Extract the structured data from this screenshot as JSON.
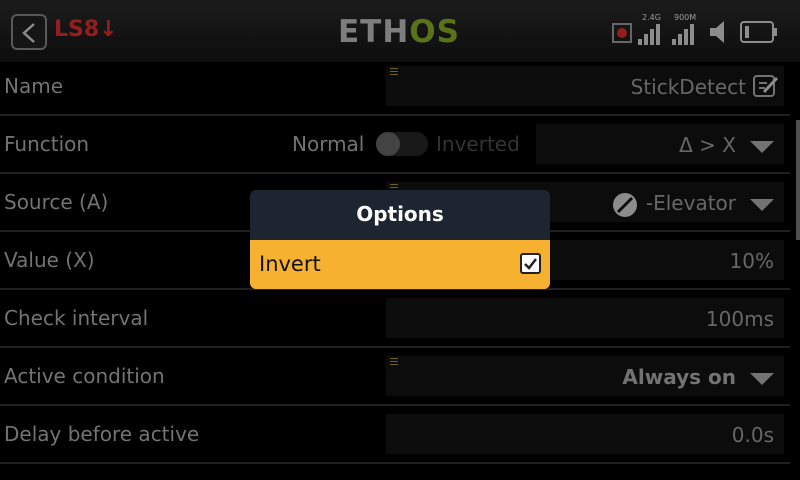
{
  "header": {
    "title": "LS8",
    "title_arrow": "↓",
    "logo_a": "ETH",
    "logo_b": "OS"
  },
  "status": {
    "rf1_label": "2.4G",
    "rf2_label": "900M"
  },
  "rows": [
    {
      "label": "Name",
      "value": "StickDetect"
    },
    {
      "label": "Function",
      "normal": "Normal",
      "inverted": "Inverted",
      "value": "Δ > X"
    },
    {
      "label": "Source (A)",
      "value": "-Elevator"
    },
    {
      "label": "Value (X)",
      "value": "10%"
    },
    {
      "label": "Check interval",
      "value": "100ms"
    },
    {
      "label": "Active condition",
      "value": "Always on"
    },
    {
      "label": "Delay before active",
      "value": "0.0s"
    }
  ],
  "dialog": {
    "title": "Options",
    "item": "Invert",
    "checked": true
  }
}
